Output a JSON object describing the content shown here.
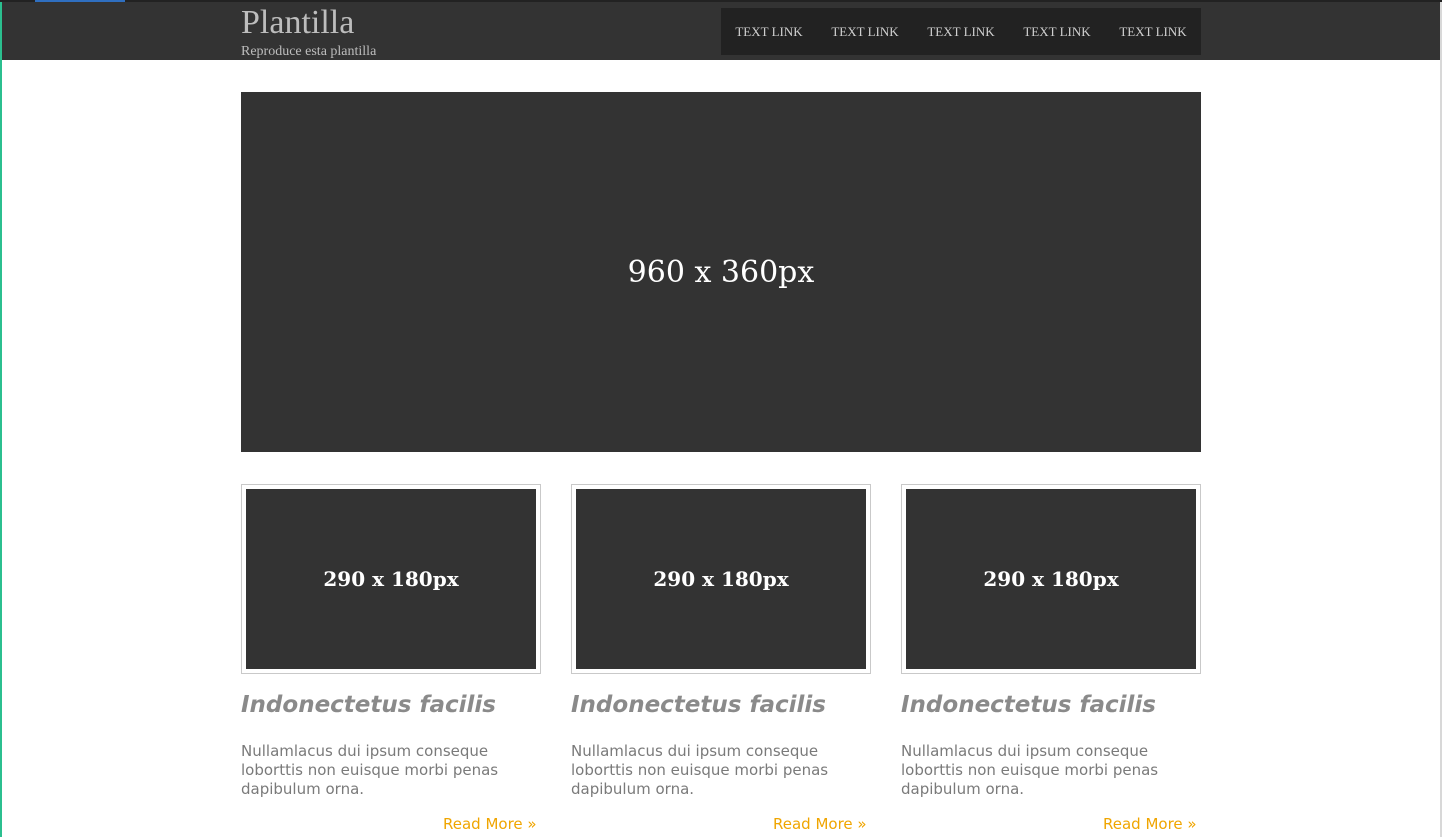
{
  "header": {
    "logo": "Plantilla",
    "tagline": "Reproduce esta plantilla",
    "nav": [
      "TEXT LINK",
      "TEXT LINK",
      "TEXT LINK",
      "TEXT LINK",
      "TEXT LINK"
    ]
  },
  "hero": {
    "label": "960 x 360px"
  },
  "cards": [
    {
      "thumb_label": "290 x 180px",
      "title": "Indonectetus facilis",
      "text": "Nullamlacus dui ipsum conseque loborttis non euisque morbi penas dapibulum orna.",
      "link": "Read More »"
    },
    {
      "thumb_label": "290 x 180px",
      "title": "Indonectetus facilis",
      "text": "Nullamlacus dui ipsum conseque loborttis non euisque morbi penas dapibulum orna.",
      "link": "Read More »"
    },
    {
      "thumb_label": "290 x 180px",
      "title": "Indonectetus facilis",
      "text": "Nullamlacus dui ipsum conseque loborttis non euisque morbi penas dapibulum orna.",
      "link": "Read More »"
    }
  ],
  "colors": {
    "header_bg": "#333333",
    "nav_bg": "#222222",
    "placeholder_bg": "#333333",
    "link_accent": "#f0a500"
  }
}
